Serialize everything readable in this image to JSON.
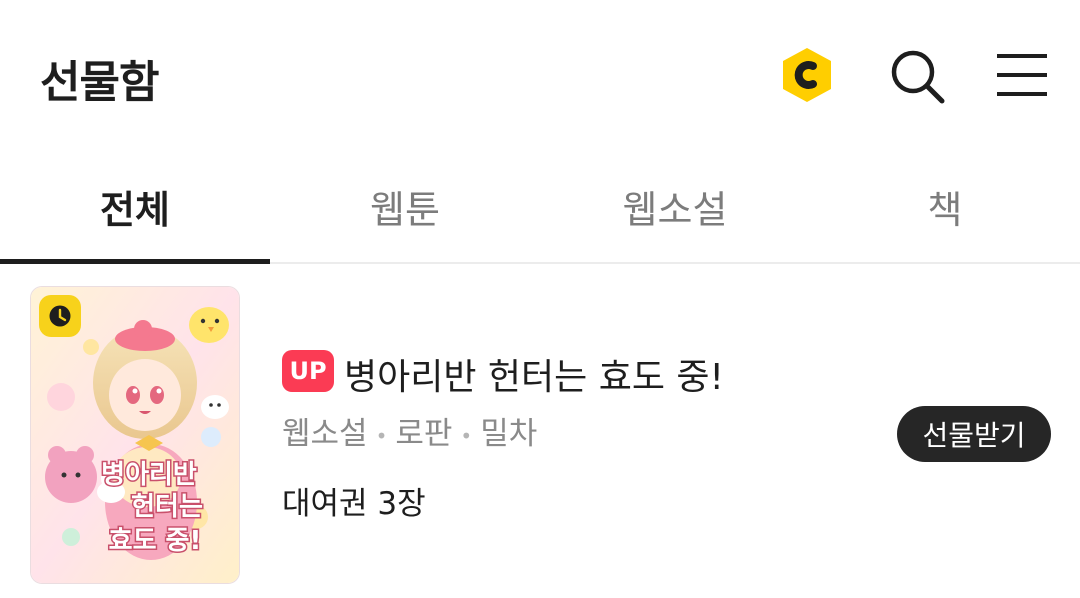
{
  "header": {
    "title": "선물함",
    "icons": [
      "coin-icon",
      "search-icon",
      "menu-icon"
    ],
    "colors": {
      "coin": "#FFCE00",
      "text": "#1E1E1E"
    }
  },
  "tabs": [
    {
      "label": "전체",
      "active": true
    },
    {
      "label": "웹툰",
      "active": false
    },
    {
      "label": "웹소설",
      "active": false
    },
    {
      "label": "책",
      "active": false
    }
  ],
  "gift_item": {
    "badge": "UP",
    "title": "병아리반 헌터는 효도 중!",
    "meta": [
      "웹소설",
      "로판",
      "밀차"
    ],
    "rental": "대여권 3장",
    "button_label": "선물받기",
    "cover_text": [
      "병아리반",
      "헌터는",
      "효도 중!"
    ],
    "cover_icon": "clock-icon",
    "colors": {
      "badge": "#FB3B54",
      "button": "#262626",
      "clock_badge": "#F7D21B"
    }
  }
}
